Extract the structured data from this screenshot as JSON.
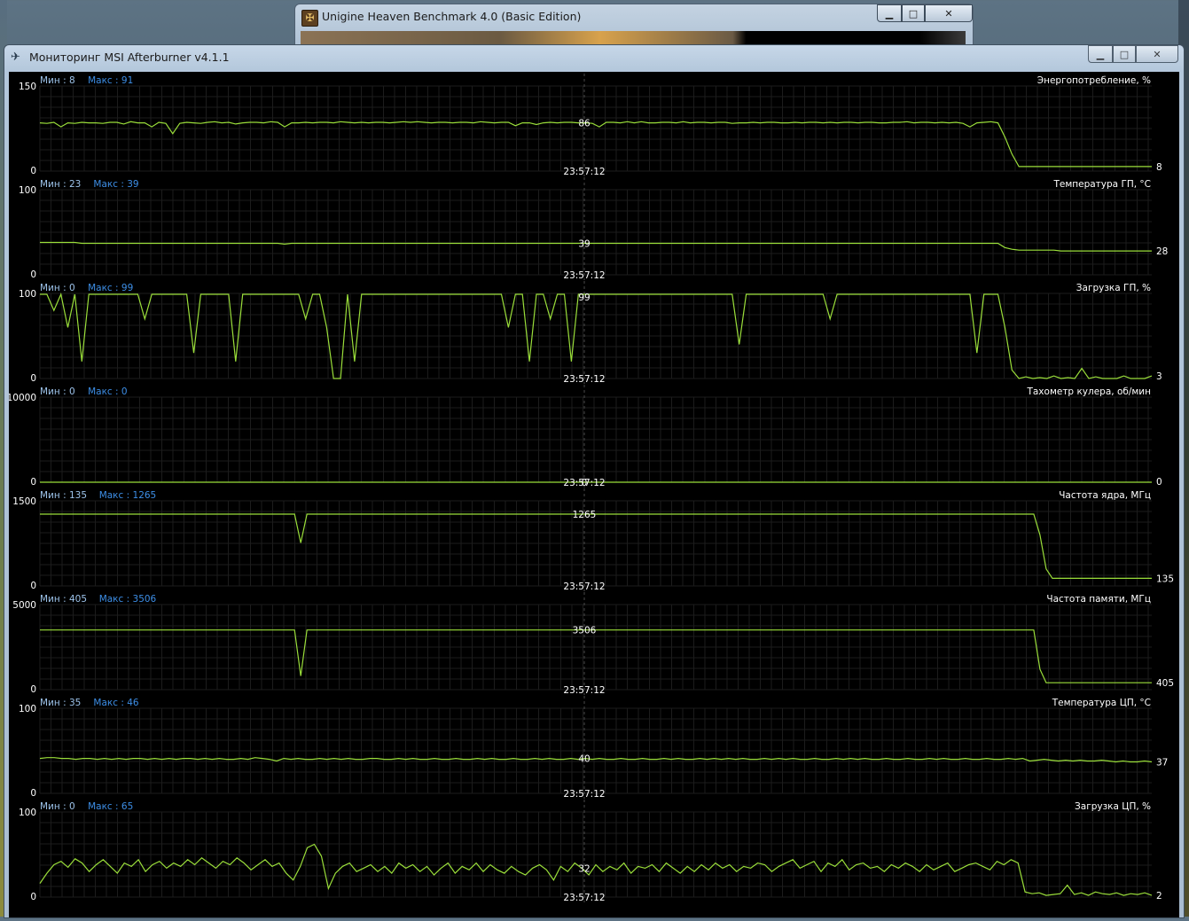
{
  "background_window": {
    "title": "Unigine Heaven Benchmark 4.0 (Basic Edition)",
    "icon": "unigine-app-icon"
  },
  "main_window": {
    "title": "Мониторинг MSI Afterburner v4.1.1",
    "icon": "afterburner-plane-icon"
  },
  "colors": {
    "line": "#9ade3a",
    "min_label": "#9dc3ea",
    "max_label": "#3d8ee6",
    "grid": "#1c1c1c",
    "text": "#ffffff"
  },
  "cursor_time": "23:57:12",
  "chart_data": [
    {
      "type": "line",
      "title": "Энергопотребление, %",
      "min_label": "Мин : 8",
      "max_label": "Макс : 91",
      "ylim": [
        0,
        150
      ],
      "y_top_label": "150",
      "y_bottom_label": "0",
      "cursor_value": "86",
      "current_value": "8",
      "y": [
        85,
        84,
        86,
        78,
        85,
        84,
        86,
        85,
        85,
        84,
        86,
        86,
        83,
        87,
        85,
        85,
        78,
        86,
        84,
        66,
        84,
        86,
        85,
        84,
        86,
        87,
        85,
        86,
        83,
        85,
        86,
        86,
        85,
        87,
        86,
        78,
        85,
        85,
        86,
        85,
        86,
        86,
        85,
        87,
        86,
        85,
        86,
        85,
        86,
        86,
        85,
        86,
        87,
        86,
        87,
        86,
        85,
        86,
        86,
        85,
        86,
        86,
        85,
        87,
        86,
        85,
        86,
        86,
        80,
        85,
        85,
        82,
        85,
        86,
        85,
        86,
        86,
        85,
        85,
        84,
        78,
        86,
        86,
        85,
        87,
        85,
        87,
        85,
        85,
        86,
        86,
        85,
        87,
        85,
        86,
        86,
        85,
        86,
        86,
        84,
        85,
        85,
        86,
        85,
        86,
        86,
        85,
        85,
        86,
        85,
        86,
        86,
        85,
        86,
        85,
        86,
        86,
        85,
        86,
        86,
        85,
        85,
        86,
        86,
        87,
        85,
        86,
        86,
        85,
        86,
        85,
        86,
        84,
        78,
        85,
        86,
        87,
        85,
        60,
        30,
        8,
        8,
        8,
        8,
        8,
        8,
        8,
        8,
        8,
        8,
        8,
        8,
        8,
        8,
        8,
        8,
        8,
        8,
        8,
        8
      ]
    },
    {
      "type": "line",
      "title": "Температура ГП, °С",
      "min_label": "Мин : 23",
      "max_label": "Макс : 39",
      "ylim": [
        0,
        100
      ],
      "y_top_label": "100",
      "y_bottom_label": "0",
      "cursor_value": "39",
      "current_value": "28",
      "y": [
        38,
        38,
        38,
        38,
        38,
        38,
        37,
        37,
        37,
        37,
        37,
        37,
        37,
        37,
        37,
        37,
        37,
        37,
        37,
        37,
        37,
        37,
        37,
        37,
        37,
        37,
        37,
        37,
        37,
        37,
        37,
        37,
        37,
        37,
        37,
        36,
        37,
        37,
        37,
        37,
        37,
        37,
        37,
        37,
        37,
        37,
        37,
        37,
        37,
        37,
        37,
        37,
        37,
        37,
        37,
        37,
        37,
        37,
        37,
        37,
        37,
        37,
        37,
        37,
        37,
        37,
        37,
        37,
        37,
        37,
        37,
        37,
        37,
        37,
        37,
        37,
        37,
        37,
        37,
        37,
        37,
        37,
        37,
        37,
        37,
        37,
        37,
        37,
        37,
        37,
        37,
        37,
        37,
        37,
        37,
        37,
        37,
        37,
        37,
        37,
        37,
        37,
        37,
        37,
        37,
        37,
        37,
        37,
        37,
        37,
        37,
        37,
        37,
        37,
        37,
        37,
        37,
        37,
        37,
        37,
        37,
        37,
        37,
        37,
        37,
        37,
        37,
        37,
        37,
        37,
        37,
        37,
        37,
        37,
        37,
        37,
        37,
        37,
        32,
        30,
        29,
        29,
        29,
        29,
        29,
        29,
        28,
        28,
        28,
        28,
        28,
        28,
        28,
        28,
        28,
        28,
        28,
        28,
        28,
        28
      ]
    },
    {
      "type": "line",
      "title": "Загрузка ГП, %",
      "min_label": "Мин : 0",
      "max_label": "Макс : 99",
      "ylim": [
        0,
        100
      ],
      "y_top_label": "100",
      "y_bottom_label": "0",
      "cursor_value": "99",
      "current_value": "3",
      "y": [
        99,
        99,
        80,
        99,
        60,
        99,
        20,
        99,
        99,
        99,
        99,
        99,
        99,
        99,
        99,
        70,
        99,
        99,
        99,
        99,
        99,
        99,
        30,
        99,
        99,
        99,
        99,
        99,
        20,
        99,
        99,
        99,
        99,
        99,
        99,
        99,
        99,
        99,
        70,
        99,
        99,
        60,
        0,
        0,
        99,
        20,
        99,
        99,
        99,
        99,
        99,
        99,
        99,
        99,
        99,
        99,
        99,
        99,
        99,
        99,
        99,
        99,
        99,
        99,
        99,
        99,
        99,
        60,
        99,
        99,
        20,
        99,
        99,
        70,
        99,
        99,
        20,
        99,
        99,
        99,
        99,
        99,
        99,
        99,
        99,
        99,
        99,
        99,
        99,
        99,
        99,
        99,
        99,
        99,
        99,
        99,
        99,
        99,
        99,
        99,
        40,
        99,
        99,
        99,
        99,
        99,
        99,
        99,
        99,
        99,
        99,
        99,
        99,
        70,
        99,
        99,
        99,
        99,
        99,
        99,
        99,
        99,
        99,
        99,
        99,
        99,
        99,
        99,
        99,
        99,
        99,
        99,
        99,
        99,
        30,
        99,
        99,
        99,
        60,
        10,
        0,
        2,
        0,
        1,
        0,
        3,
        0,
        1,
        0,
        12,
        0,
        2,
        0,
        0,
        0,
        3,
        0,
        0,
        0,
        3
      ]
    },
    {
      "type": "line",
      "title": "Тахометр кулера, об/мин",
      "min_label": "Мин : 0",
      "max_label": "Макс : 0",
      "ylim": [
        0,
        10000
      ],
      "y_top_label": "10000",
      "y_bottom_label": "0",
      "cursor_value": "0",
      "current_value": "0",
      "y": [
        0,
        0,
        0,
        0,
        0,
        0,
        0,
        0,
        0,
        0,
        0,
        0,
        0,
        0,
        0,
        0,
        0,
        0,
        0,
        0,
        0,
        0,
        0,
        0,
        0,
        0,
        0,
        0,
        0,
        0,
        0,
        0,
        0,
        0,
        0,
        0,
        0,
        0,
        0,
        0,
        0,
        0,
        0,
        0,
        0,
        0,
        0,
        0,
        0,
        0,
        0,
        0,
        0,
        0,
        0,
        0,
        0,
        0,
        0,
        0,
        0,
        0,
        0,
        0,
        0,
        0,
        0,
        0,
        0,
        0,
        0,
        0,
        0,
        0,
        0,
        0,
        0,
        0,
        0,
        0,
        0,
        0,
        0,
        0,
        0,
        0,
        0,
        0,
        0,
        0,
        0,
        0,
        0,
        0,
        0,
        0,
        0,
        0,
        0,
        0,
        0,
        0,
        0,
        0,
        0,
        0,
        0,
        0,
        0,
        0,
        0,
        0,
        0,
        0,
        0,
        0,
        0,
        0,
        0,
        0,
        0,
        0,
        0,
        0,
        0,
        0,
        0,
        0,
        0,
        0,
        0,
        0,
        0,
        0,
        0,
        0,
        0,
        0,
        0,
        0,
        0,
        0,
        0,
        0,
        0,
        0,
        0,
        0,
        0,
        0,
        0,
        0,
        0,
        0,
        0,
        0,
        0,
        0,
        0,
        0
      ]
    },
    {
      "type": "line",
      "title": "Частота ядра, МГц",
      "min_label": "Мин : 135",
      "max_label": "Макс : 1265",
      "ylim": [
        0,
        1500
      ],
      "y_top_label": "1500",
      "y_bottom_label": "0",
      "cursor_value": "1265",
      "current_value": "135",
      "y": [
        1265,
        1265,
        1265,
        1265,
        1265,
        1265,
        1265,
        1265,
        1265,
        1265,
        1265,
        1265,
        1265,
        1265,
        1265,
        1265,
        1265,
        1265,
        1265,
        1265,
        1265,
        1265,
        1265,
        1265,
        1265,
        1265,
        1265,
        1265,
        1265,
        1265,
        1265,
        1265,
        1265,
        1265,
        1265,
        1265,
        1265,
        1265,
        1265,
        1265,
        1265,
        1265,
        760,
        1265,
        1265,
        1265,
        1265,
        1265,
        1265,
        1265,
        1265,
        1265,
        1265,
        1265,
        1265,
        1265,
        1265,
        1265,
        1265,
        1265,
        1265,
        1265,
        1265,
        1265,
        1265,
        1265,
        1265,
        1265,
        1265,
        1265,
        1265,
        1265,
        1265,
        1265,
        1265,
        1265,
        1265,
        1265,
        1265,
        1265,
        1265,
        1265,
        1265,
        1265,
        1265,
        1265,
        1265,
        1265,
        1265,
        1265,
        1265,
        1265,
        1265,
        1265,
        1265,
        1265,
        1265,
        1265,
        1265,
        1265,
        1265,
        1265,
        1265,
        1265,
        1265,
        1265,
        1265,
        1265,
        1265,
        1265,
        1265,
        1265,
        1265,
        1265,
        1265,
        1265,
        1265,
        1265,
        1265,
        1265,
        1265,
        1265,
        1265,
        1265,
        1265,
        1265,
        1265,
        1265,
        1265,
        1265,
        1265,
        1265,
        1265,
        1265,
        1265,
        1265,
        1265,
        1265,
        1265,
        1265,
        1265,
        1265,
        1265,
        1265,
        1265,
        1265,
        1265,
        1265,
        1265,
        1265,
        1265,
        1265,
        1265,
        1265,
        1265,
        1265,
        1265,
        1265,
        1265,
        1265,
        1265,
        900,
        300,
        135,
        135,
        135,
        135,
        135,
        135,
        135,
        135,
        135,
        135,
        135,
        135,
        135,
        135,
        135,
        135,
        135
      ]
    },
    {
      "type": "line",
      "title": "Частота памяти, МГц",
      "min_label": "Мин : 405",
      "max_label": "Макс : 3506",
      "ylim": [
        0,
        5000
      ],
      "y_top_label": "5000",
      "y_bottom_label": "0",
      "cursor_value": "3506",
      "current_value": "405",
      "y": [
        3506,
        3506,
        3506,
        3506,
        3506,
        3506,
        3506,
        3506,
        3506,
        3506,
        3506,
        3506,
        3506,
        3506,
        3506,
        3506,
        3506,
        3506,
        3506,
        3506,
        3506,
        3506,
        3506,
        3506,
        3506,
        3506,
        3506,
        3506,
        3506,
        3506,
        3506,
        3506,
        3506,
        3506,
        3506,
        3506,
        3506,
        3506,
        3506,
        3506,
        3506,
        3506,
        800,
        3506,
        3506,
        3506,
        3506,
        3506,
        3506,
        3506,
        3506,
        3506,
        3506,
        3506,
        3506,
        3506,
        3506,
        3506,
        3506,
        3506,
        3506,
        3506,
        3506,
        3506,
        3506,
        3506,
        3506,
        3506,
        3506,
        3506,
        3506,
        3506,
        3506,
        3506,
        3506,
        3506,
        3506,
        3506,
        3506,
        3506,
        3506,
        3506,
        3506,
        3506,
        3506,
        3506,
        3506,
        3506,
        3506,
        3506,
        3506,
        3506,
        3506,
        3506,
        3506,
        3506,
        3506,
        3506,
        3506,
        3506,
        3506,
        3506,
        3506,
        3506,
        3506,
        3506,
        3506,
        3506,
        3506,
        3506,
        3506,
        3506,
        3506,
        3506,
        3506,
        3506,
        3506,
        3506,
        3506,
        3506,
        3506,
        3506,
        3506,
        3506,
        3506,
        3506,
        3506,
        3506,
        3506,
        3506,
        3506,
        3506,
        3506,
        3506,
        3506,
        3506,
        3506,
        3506,
        3506,
        3506,
        3506,
        3506,
        3506,
        3506,
        3506,
        3506,
        3506,
        3506,
        3506,
        3506,
        3506,
        3506,
        3506,
        3506,
        3506,
        3506,
        3506,
        3506,
        3506,
        3506,
        3506,
        1200,
        405,
        405,
        405,
        405,
        405,
        405,
        405,
        405,
        405,
        405,
        405,
        405,
        405,
        405,
        405,
        405,
        405,
        405
      ]
    },
    {
      "type": "line",
      "title": "Температура ЦП, °С",
      "min_label": "Мин : 35",
      "max_label": "Макс : 46",
      "ylim": [
        0,
        100
      ],
      "y_top_label": "100",
      "y_bottom_label": "0",
      "cursor_value": "40",
      "current_value": "37",
      "y": [
        41,
        42,
        42,
        41,
        41,
        40,
        41,
        41,
        40,
        41,
        40,
        41,
        40,
        41,
        41,
        40,
        41,
        40,
        41,
        40,
        41,
        41,
        40,
        41,
        40,
        41,
        40,
        40,
        41,
        40,
        42,
        41,
        40,
        38,
        41,
        40,
        41,
        40,
        40,
        41,
        40,
        41,
        40,
        41,
        40,
        40,
        41,
        41,
        40,
        40,
        41,
        40,
        41,
        40,
        40,
        41,
        40,
        40,
        41,
        40,
        40,
        41,
        40,
        41,
        40,
        40,
        41,
        40,
        40,
        41,
        40,
        41,
        40,
        40,
        41,
        40,
        41,
        40,
        41,
        40,
        40,
        41,
        40,
        40,
        41,
        40,
        40,
        41,
        40,
        41,
        40,
        40,
        41,
        40,
        41,
        40,
        41,
        40,
        41,
        40,
        40,
        41,
        40,
        41,
        40,
        41,
        40,
        40,
        41,
        40,
        40,
        41,
        40,
        41,
        40,
        41,
        40,
        40,
        41,
        40,
        40,
        41,
        40,
        40,
        41,
        40,
        41,
        40,
        40,
        41,
        40,
        40,
        41,
        40,
        40,
        41,
        40,
        41,
        38,
        39,
        40,
        39,
        38,
        39,
        38,
        39,
        38,
        38,
        39,
        38,
        37,
        38,
        37,
        37,
        38,
        37
      ]
    },
    {
      "type": "line",
      "title": "Загрузка ЦП, %",
      "min_label": "Мин : 0",
      "max_label": "Макс : 65",
      "ylim": [
        0,
        100
      ],
      "y_top_label": "100",
      "y_bottom_label": "0",
      "cursor_value": "32",
      "current_value": "2",
      "y": [
        16,
        28,
        38,
        42,
        35,
        45,
        40,
        30,
        38,
        44,
        36,
        28,
        40,
        36,
        44,
        30,
        38,
        42,
        34,
        40,
        36,
        44,
        38,
        46,
        40,
        34,
        42,
        38,
        46,
        40,
        32,
        38,
        44,
        36,
        40,
        28,
        20,
        36,
        58,
        62,
        48,
        10,
        28,
        36,
        40,
        30,
        34,
        38,
        30,
        36,
        28,
        40,
        34,
        38,
        30,
        36,
        26,
        34,
        40,
        28,
        36,
        32,
        40,
        30,
        38,
        32,
        28,
        36,
        30,
        26,
        34,
        38,
        32,
        20,
        36,
        30,
        40,
        34,
        26,
        38,
        30,
        36,
        32,
        40,
        28,
        36,
        34,
        38,
        30,
        40,
        34,
        28,
        36,
        30,
        38,
        32,
        40,
        34,
        38,
        30,
        36,
        34,
        40,
        38,
        30,
        36,
        40,
        44,
        34,
        38,
        42,
        30,
        40,
        36,
        44,
        32,
        38,
        40,
        34,
        36,
        30,
        38,
        34,
        40,
        36,
        30,
        38,
        32,
        36,
        40,
        30,
        34,
        38,
        40,
        36,
        32,
        42,
        38,
        44,
        40,
        6,
        4,
        5,
        2,
        3,
        4,
        14,
        3,
        5,
        2,
        6,
        4,
        3,
        5,
        2,
        4,
        3,
        5,
        2
      ]
    }
  ]
}
